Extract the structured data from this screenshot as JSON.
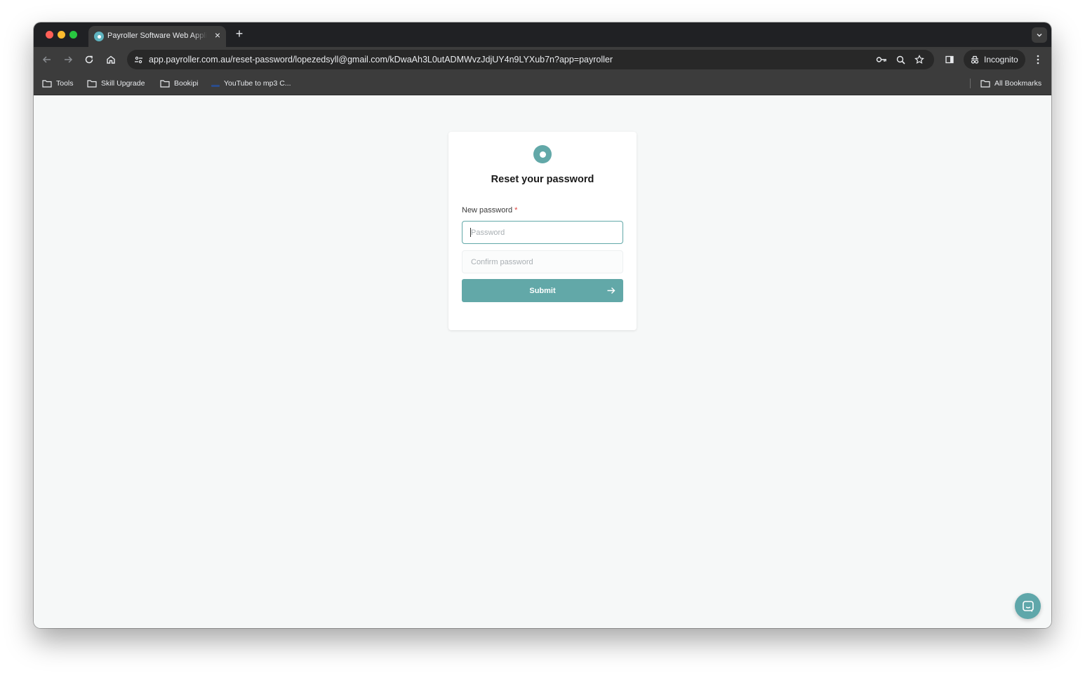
{
  "browser": {
    "tab": {
      "title": "Payroller Software Web Application",
      "close_glyph": "×"
    },
    "new_tab_glyph": "+",
    "url": "app.payroller.com.au/reset-password/lopezedsyll@gmail.com/kDwaAh3L0utADMWvzJdjUY4n9LYXub7n?app=payroller",
    "incognito_label": "Incognito",
    "bookmarks": [
      {
        "label": "Tools",
        "icon": "folder-icon"
      },
      {
        "label": "Skill Upgrade",
        "icon": "folder-icon"
      },
      {
        "label": "Bookipi",
        "icon": "folder-icon"
      },
      {
        "label": "YouTube to mp3 C...",
        "icon": "site-favicon"
      }
    ],
    "all_bookmarks_label": "All Bookmarks"
  },
  "reset_form": {
    "title": "Reset your password",
    "new_password_label": "New password",
    "required_marker": "*",
    "password_placeholder": "Password",
    "confirm_placeholder": "Confirm password",
    "submit_label": "Submit"
  },
  "colors": {
    "accent": "#62a8a8",
    "page_bg": "#f6f8f8",
    "required": "#e0443e"
  }
}
